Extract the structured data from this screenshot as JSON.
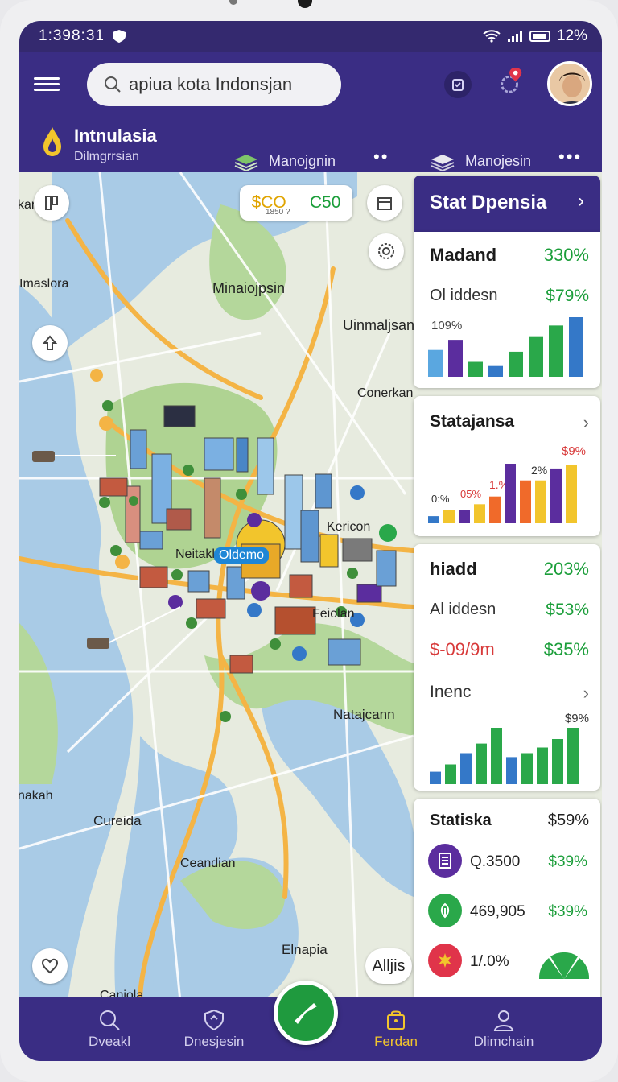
{
  "status": {
    "time": "1:398:31",
    "battery": "12%"
  },
  "search": {
    "text": "apiua kota Indonsjan"
  },
  "brand": {
    "title": "Intnulasia",
    "subtitle": "Dilmgrrsian"
  },
  "nav": {
    "link1": "Manojgnin",
    "link2": "Manojesin"
  },
  "map": {
    "price_chip_left": "$CO",
    "price_chip_small": "1850 ?",
    "price_chip_right": "C50",
    "labels": {
      "karik": "karik",
      "imaslora": "Imaslora",
      "minaiojpsin": "Minaiojpsin",
      "uinmaljsan": "Uinmaljsan",
      "conerkan": "Conerkan",
      "kericon": "Kericon",
      "neitakl": "Neitakl",
      "oldemo": "Oldemo",
      "feiolan": "Feiolan",
      "natajcann": "Natajcann",
      "nakah": "nakah",
      "cureida": "Cureida",
      "ceandian": "Ceandian",
      "elnapia": "Elnapia",
      "caniola": "Caniola",
      "alljis": "Alljis"
    }
  },
  "stats_panel": {
    "header": "Stat Dpensia",
    "card1": {
      "title": "Madand",
      "title_value": "330%",
      "row_label": "Ol iddesn",
      "row_value": "$79%",
      "chart_label": "109%",
      "bars": [
        {
          "v": 0.45,
          "c": "#5aa7e0"
        },
        {
          "v": 0.62,
          "c": "#5b2d9e"
        },
        {
          "v": 0.25,
          "c": "#2aa84a"
        },
        {
          "v": 0.18,
          "c": "#3478c8"
        },
        {
          "v": 0.42,
          "c": "#2aa84a"
        },
        {
          "v": 0.68,
          "c": "#2aa84a"
        },
        {
          "v": 0.86,
          "c": "#2aa84a"
        },
        {
          "v": 1.0,
          "c": "#3478c8"
        }
      ]
    },
    "card2": {
      "title": "Statajansa",
      "labels": [
        "$9%",
        "2%",
        "1.%",
        "05%",
        "0:%"
      ],
      "bars": [
        {
          "v": 0.12,
          "c": "#3478c8"
        },
        {
          "v": 0.22,
          "c": "#f2c52c"
        },
        {
          "v": 0.22,
          "c": "#5b2d9e"
        },
        {
          "v": 0.32,
          "c": "#f2c52c"
        },
        {
          "v": 0.45,
          "c": "#f06a2a"
        },
        {
          "v": 1.0,
          "c": "#5b2d9e"
        },
        {
          "v": 0.72,
          "c": "#f06a2a"
        },
        {
          "v": 0.72,
          "c": "#f2c52c"
        },
        {
          "v": 0.92,
          "c": "#5b2d9e"
        },
        {
          "v": 0.98,
          "c": "#f2c52c"
        }
      ]
    },
    "card3": {
      "title": "hiadd",
      "title_value": "203%",
      "row1_label": "Al iddesn",
      "row1_value": "$53%",
      "row2_label": "$-09/9m",
      "row2_value": "$35%",
      "sub_title": "Inenc",
      "chart_label": "$9%",
      "bars": [
        {
          "v": 0.22,
          "c": "#3478c8"
        },
        {
          "v": 0.35,
          "c": "#2aa84a"
        },
        {
          "v": 0.55,
          "c": "#3478c8"
        },
        {
          "v": 0.72,
          "c": "#2aa84a"
        },
        {
          "v": 1.0,
          "c": "#2aa84a"
        },
        {
          "v": 0.48,
          "c": "#3478c8"
        },
        {
          "v": 0.55,
          "c": "#2aa84a"
        },
        {
          "v": 0.65,
          "c": "#2aa84a"
        },
        {
          "v": 0.8,
          "c": "#2aa84a"
        },
        {
          "v": 1.0,
          "c": "#2aa84a"
        }
      ]
    },
    "card4": {
      "title": "Statiska",
      "title_value": "$59%",
      "rows": [
        {
          "label": "Q.3500",
          "value": "$39%",
          "color": "#5b2d9e"
        },
        {
          "label": "469,905",
          "value": "$39%",
          "color": "#2aa84a"
        },
        {
          "label": "1/.0%",
          "value": "",
          "color": "#e0344a"
        }
      ]
    }
  },
  "tabs": {
    "t1": "Dveakl",
    "t2": "Dnesjesin",
    "t3": "Ferdan",
    "t4": "Dlimchain"
  }
}
